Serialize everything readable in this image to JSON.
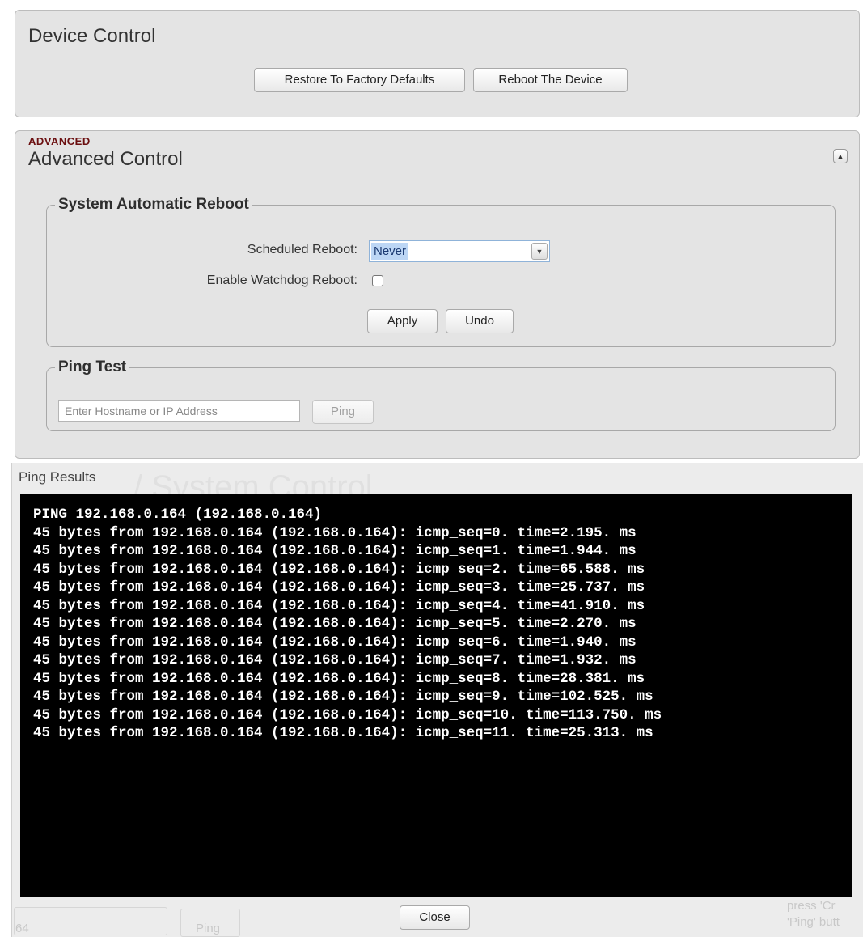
{
  "device_control": {
    "title": "Device Control",
    "restore_button": "Restore To Factory Defaults",
    "reboot_button": "Reboot The Device"
  },
  "advanced_control": {
    "tag": "ADVANCED",
    "title": "Advanced Control",
    "collapse_icon": "triangle-up-icon",
    "reboot_group": {
      "legend": "System Automatic Reboot",
      "scheduled_label": "Scheduled Reboot:",
      "scheduled_value": "Never",
      "watchdog_label": "Enable Watchdog Reboot:",
      "watchdog_checked": false,
      "apply_button": "Apply",
      "undo_button": "Undo"
    },
    "ping_group": {
      "legend": "Ping Test",
      "input_placeholder": "Enter Hostname or IP Address",
      "ping_button": "Ping"
    }
  },
  "ping_results": {
    "title": "Ping Results",
    "background_title": "/ System Control",
    "lines": [
      "PING 192.168.0.164 (192.168.0.164)",
      "45 bytes from 192.168.0.164 (192.168.0.164): icmp_seq=0. time=2.195. ms",
      "45 bytes from 192.168.0.164 (192.168.0.164): icmp_seq=1. time=1.944. ms",
      "45 bytes from 192.168.0.164 (192.168.0.164): icmp_seq=2. time=65.588. ms",
      "45 bytes from 192.168.0.164 (192.168.0.164): icmp_seq=3. time=25.737. ms",
      "45 bytes from 192.168.0.164 (192.168.0.164): icmp_seq=4. time=41.910. ms",
      "45 bytes from 192.168.0.164 (192.168.0.164): icmp_seq=5. time=2.270. ms",
      "45 bytes from 192.168.0.164 (192.168.0.164): icmp_seq=6. time=1.940. ms",
      "45 bytes from 192.168.0.164 (192.168.0.164): icmp_seq=7. time=1.932. ms",
      "45 bytes from 192.168.0.164 (192.168.0.164): icmp_seq=8. time=28.381. ms",
      "45 bytes from 192.168.0.164 (192.168.0.164): icmp_seq=9. time=102.525. ms",
      "45 bytes from 192.168.0.164 (192.168.0.164): icmp_seq=10. time=113.750. ms",
      "45 bytes from 192.168.0.164 (192.168.0.164): icmp_seq=11. time=25.313. ms"
    ],
    "close_button": "Close",
    "background_hint_1": "press 'Cr",
    "background_hint_2": "'Ping' butt",
    "background_ping_button": "Ping",
    "background_input_tail": "64"
  }
}
